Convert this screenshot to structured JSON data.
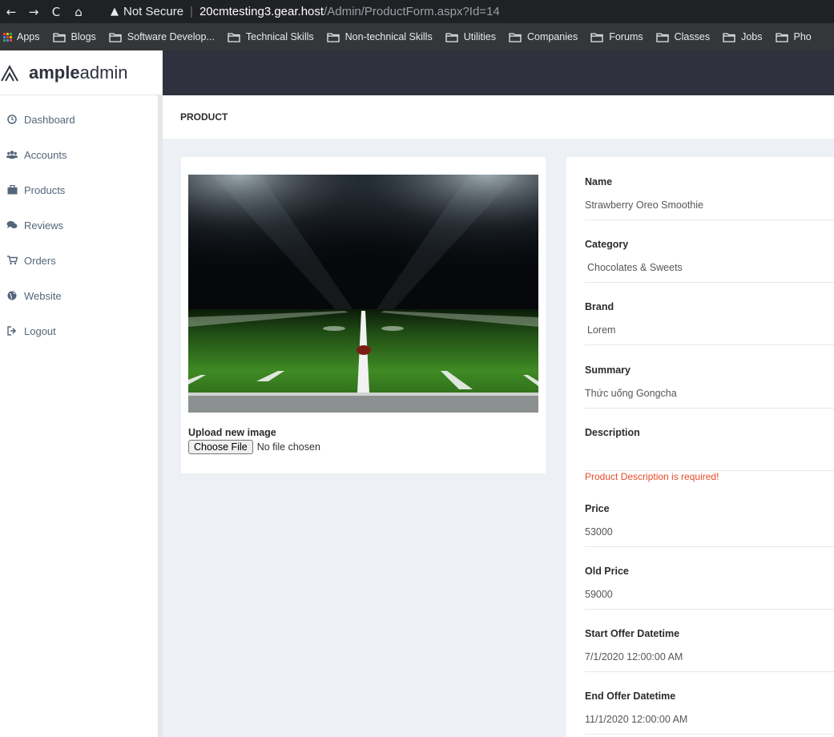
{
  "browser": {
    "nav": {
      "back": "←",
      "forward": "→",
      "reload": "C",
      "home": "⌂"
    },
    "security_label": "Not Secure",
    "url_host": "20cmtesting3.gear.host",
    "url_path": "/Admin/ProductForm.aspx?Id=14",
    "bookmarks": [
      {
        "label": "Apps",
        "icon": "apps-grid-icon"
      },
      {
        "label": "Blogs",
        "icon": "folder-icon"
      },
      {
        "label": "Software Develop...",
        "icon": "folder-icon"
      },
      {
        "label": "Technical Skills",
        "icon": "folder-icon"
      },
      {
        "label": "Non-technical Skills",
        "icon": "folder-icon"
      },
      {
        "label": "Utilities",
        "icon": "folder-icon"
      },
      {
        "label": "Companies",
        "icon": "folder-icon"
      },
      {
        "label": "Forums",
        "icon": "folder-icon"
      },
      {
        "label": "Classes",
        "icon": "folder-icon"
      },
      {
        "label": "Jobs",
        "icon": "folder-icon"
      },
      {
        "label": "Pho",
        "icon": "folder-icon"
      }
    ]
  },
  "brand": {
    "bold": "ample",
    "light": "admin"
  },
  "sidebar": {
    "items": [
      {
        "label": "Dashboard",
        "icon": "clock-icon"
      },
      {
        "label": "Accounts",
        "icon": "users-icon"
      },
      {
        "label": "Products",
        "icon": "briefcase-icon"
      },
      {
        "label": "Reviews",
        "icon": "comments-icon"
      },
      {
        "label": "Orders",
        "icon": "cart-icon"
      },
      {
        "label": "Website",
        "icon": "globe-icon"
      },
      {
        "label": "Logout",
        "icon": "sign-out-icon"
      }
    ]
  },
  "page": {
    "title": "PRODUCT"
  },
  "image_card": {
    "upload_label": "Upload new image",
    "choose_file": "Choose File",
    "no_file": "No file chosen"
  },
  "form": {
    "name": {
      "label": "Name",
      "value": "Strawberry Oreo Smoothie"
    },
    "category": {
      "label": "Category",
      "value": "Chocolates & Sweets"
    },
    "brand": {
      "label": "Brand",
      "value": "Lorem"
    },
    "summary": {
      "label": "Summary",
      "value": "Thức uống Gongcha"
    },
    "description": {
      "label": "Description",
      "value": "",
      "error": "Product Description is required!"
    },
    "price": {
      "label": "Price",
      "value": "53000"
    },
    "old_price": {
      "label": "Old Price",
      "value": "59000"
    },
    "start_offer": {
      "label": "Start Offer Datetime",
      "value": "7/1/2020 12:00:00 AM"
    },
    "end_offer": {
      "label": "End Offer Datetime",
      "value": "11/1/2020 12:00:00 AM"
    }
  },
  "colors": {
    "topbar": "#2f323e",
    "sidebar_text": "#54667a",
    "error": "#e74a25",
    "page_bg": "#edf1f5"
  }
}
